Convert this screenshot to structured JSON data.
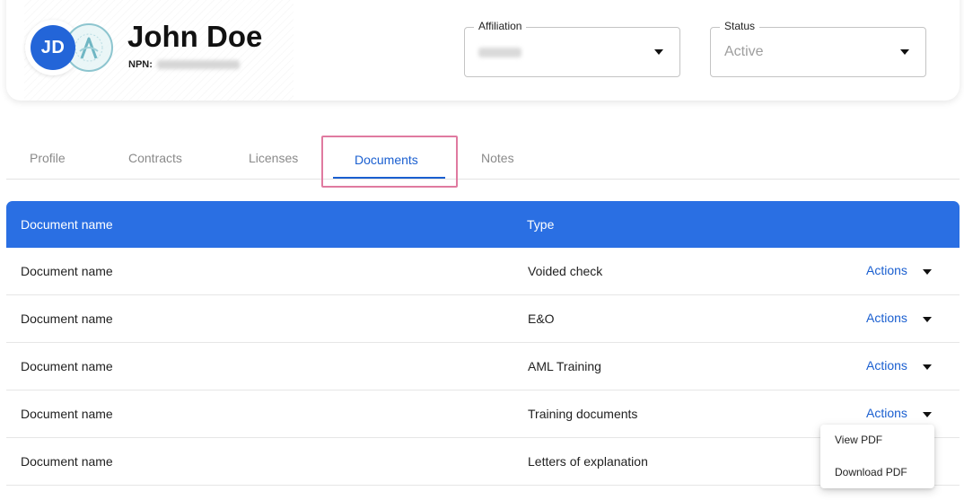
{
  "header": {
    "avatar_initials": "JD",
    "name": "John Doe",
    "npn_label": "NPN:"
  },
  "affiliation": {
    "label": "Affiliation"
  },
  "status": {
    "label": "Status",
    "value": "Active"
  },
  "tabs": [
    {
      "label": "Profile"
    },
    {
      "label": "Contracts"
    },
    {
      "label": "Licenses"
    },
    {
      "label": "Documents",
      "active": true
    },
    {
      "label": "Notes"
    }
  ],
  "table": {
    "columns": [
      "Document name",
      "Type"
    ],
    "action_label": "Actions",
    "rows": [
      {
        "name": "Document name",
        "type": "Voided check"
      },
      {
        "name": "Document name",
        "type": "E&O"
      },
      {
        "name": "Document name",
        "type": "AML Training"
      },
      {
        "name": "Document name",
        "type": "Training documents"
      },
      {
        "name": "Document name",
        "type": "Letters of explanation"
      }
    ]
  },
  "actions_menu": {
    "items": [
      "View PDF",
      "Download PDF"
    ]
  },
  "colors": {
    "accent": "#1a5fd0",
    "header_bar": "#2a6fe3",
    "highlight": "#e07aa0"
  }
}
